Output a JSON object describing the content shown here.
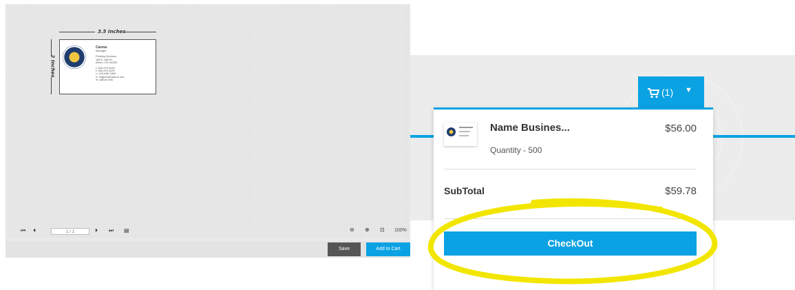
{
  "editor": {
    "width_label": "3.5 Inches",
    "height_label": "2 Inches",
    "card": {
      "name": "Carese",
      "title": "Manager",
      "org": "Printing Services",
      "address1": "185 E. Mill St.",
      "address2": "Akron, OH 44325",
      "phone1": "t: 330-972-6151",
      "phone2": "f: 330-972-6197",
      "phone3": "c: 123-456-7890",
      "email": "e: hughes@uakron.edu",
      "web": "w: uakron.edu"
    },
    "page_indicator": "1 / 1",
    "zoom": "100%",
    "save_label": "Save",
    "add_to_cart_label": "Add to Cart"
  },
  "cart": {
    "button_label": "(1)",
    "item": {
      "name": "Name Busines...",
      "price": "$56.00",
      "quantity": "Quantity - 500"
    },
    "subtotal_label": "SubTotal",
    "subtotal_value": "$59.78",
    "checkout_label": "CheckOut"
  },
  "colors": {
    "accent": "#0ba2e3",
    "highlight": "#f2e600",
    "save_button": "#555555"
  }
}
